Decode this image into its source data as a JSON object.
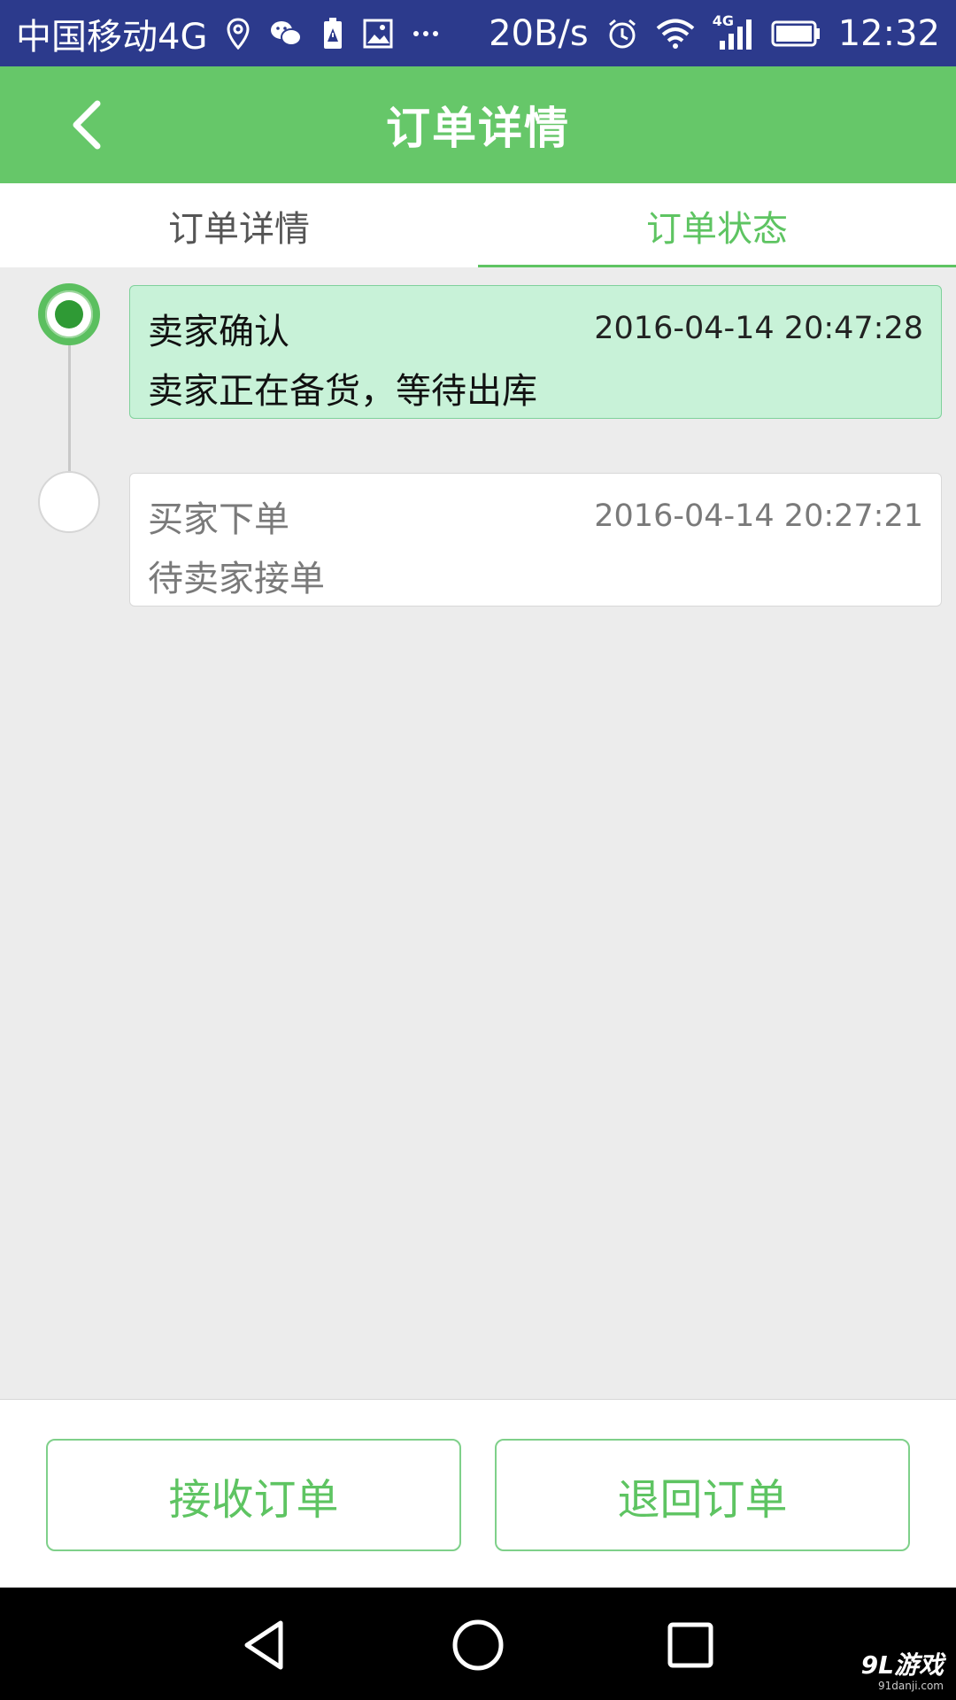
{
  "status_bar": {
    "carrier": "中国移动4G",
    "net_speed": "20B/s",
    "net_badge": "4G",
    "time": "12:32",
    "icons": [
      "location-icon",
      "wechat-icon",
      "battery-alert-icon",
      "image-icon",
      "more-icon",
      "alarm-icon",
      "wifi-icon",
      "signal-icon",
      "battery-icon"
    ]
  },
  "header": {
    "title": "订单详情",
    "back_icon": "chevron-left-icon"
  },
  "tabs": [
    {
      "label": "订单详情",
      "active": false
    },
    {
      "label": "订单状态",
      "active": true
    }
  ],
  "timeline": [
    {
      "title": "卖家确认",
      "time": "2016-04-14 20:47:28",
      "desc": "卖家正在备货，等待出库",
      "active": true
    },
    {
      "title": "买家下单",
      "time": "2016-04-14 20:27:21",
      "desc": "待卖家接单",
      "active": false
    }
  ],
  "actions": {
    "accept_label": "接收订单",
    "reject_label": "退回订单"
  },
  "watermark": {
    "main": "9L游戏",
    "sub": "91danji.com"
  },
  "colors": {
    "status_bar": "#2c3a8c",
    "accent_green": "#66c769",
    "active_card_bg": "#c8f2d8",
    "page_bg": "#ececec"
  }
}
